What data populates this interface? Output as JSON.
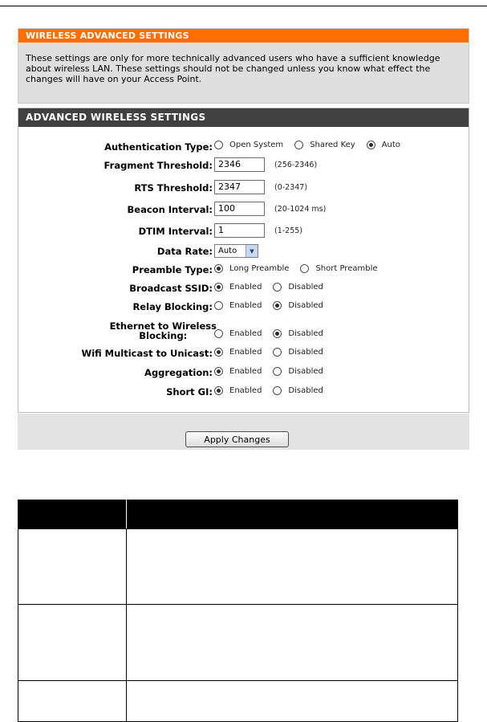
{
  "intro": {
    "title": "WIRELESS ADVANCED SETTINGS",
    "description": "These settings are only for more technically advanced users who have a sufficient knowledge about wireless LAN. These settings should not be changed unless you know what effect the changes will have on your Access Point."
  },
  "advanced": {
    "title": "ADVANCED WIRELESS SETTINGS",
    "auth_type": {
      "label": "Authentication Type:",
      "options": [
        "Open System",
        "Shared Key",
        "Auto"
      ],
      "selected": "Auto"
    },
    "fragment": {
      "label": "Fragment Threshold:",
      "value": "2346",
      "range": "(256-2346)"
    },
    "rts": {
      "label": "RTS Threshold:",
      "value": "2347",
      "range": "(0-2347)"
    },
    "beacon": {
      "label": "Beacon Interval:",
      "value": "100",
      "range": "(20-1024 ms)"
    },
    "dtim": {
      "label": "DTIM Interval:",
      "value": "1",
      "range": "(1-255)"
    },
    "data_rate": {
      "label": "Data Rate:",
      "value": "Auto"
    },
    "preamble": {
      "label": "Preamble Type:",
      "options": [
        "Long Preamble",
        "Short Preamble"
      ],
      "selected": "Long Preamble"
    },
    "broadcast_ssid": {
      "label": "Broadcast SSID:",
      "options": [
        "Enabled",
        "Disabled"
      ],
      "selected": "Enabled"
    },
    "relay_blocking": {
      "label": "Relay Blocking:",
      "options": [
        "Enabled",
        "Disabled"
      ],
      "selected": "Disabled"
    },
    "eth_blocking": {
      "label_line1": "Ethernet to Wireless",
      "label_line2": "Blocking:",
      "options": [
        "Enabled",
        "Disabled"
      ],
      "selected": "Disabled"
    },
    "multicast": {
      "label": "Wifi Multicast to Unicast:",
      "options": [
        "Enabled",
        "Disabled"
      ],
      "selected": "Enabled"
    },
    "aggregation": {
      "label": "Aggregation:",
      "options": [
        "Enabled",
        "Disabled"
      ],
      "selected": "Enabled"
    },
    "short_gi": {
      "label": "Short GI:",
      "options": [
        "Enabled",
        "Disabled"
      ],
      "selected": "Enabled"
    }
  },
  "apply_label": "Apply Changes",
  "colors": {
    "intro_header": "#ff6f00",
    "section_header": "#404040",
    "intro_body": "#dfdfdf",
    "apply_bar": "#e3e3e3"
  }
}
